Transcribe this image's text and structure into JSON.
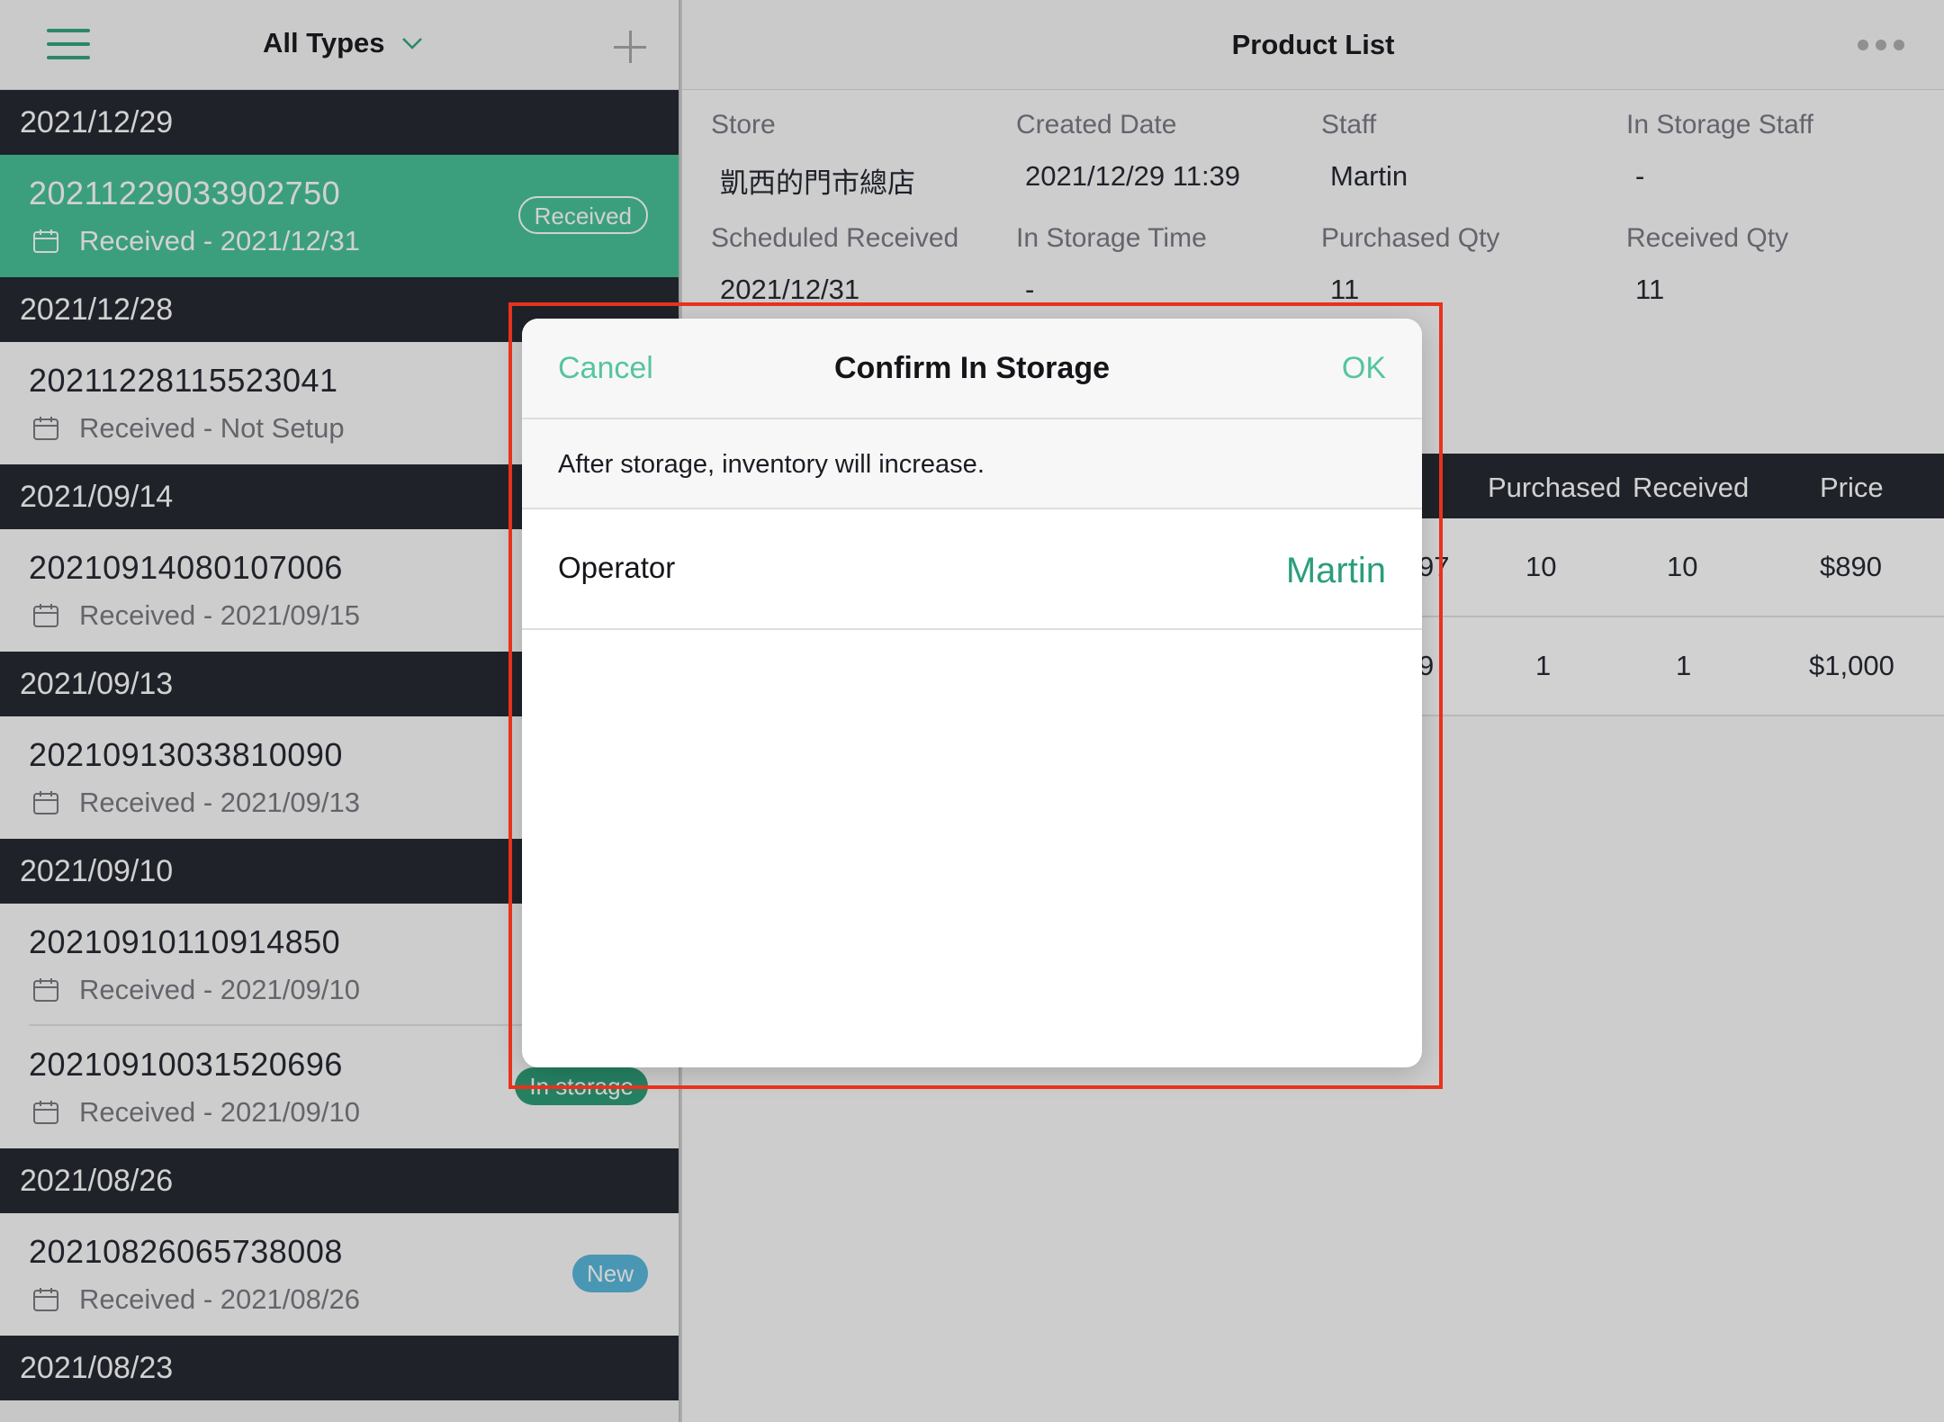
{
  "sidebar": {
    "filter_label": "All Types",
    "groups": [
      {
        "date": "2021/12/29",
        "orders": [
          {
            "number": "20211229033902750",
            "status": "Received - 2021/12/31",
            "badge": "Received"
          }
        ]
      },
      {
        "date": "2021/12/28",
        "orders": [
          {
            "number": "20211228115523041",
            "status": "Received - Not Setup"
          }
        ]
      },
      {
        "date": "2021/09/14",
        "orders": [
          {
            "number": "20210914080107006",
            "status": "Received - 2021/09/15"
          }
        ]
      },
      {
        "date": "2021/09/13",
        "orders": [
          {
            "number": "20210913033810090",
            "status": "Received - 2021/09/13"
          }
        ]
      },
      {
        "date": "2021/09/10",
        "orders": [
          {
            "number": "20210910110914850",
            "status": "Received - 2021/09/10"
          },
          {
            "number": "20210910031520696",
            "status": "Received - 2021/09/10",
            "badge": "In storage"
          }
        ]
      },
      {
        "date": "2021/08/26",
        "orders": [
          {
            "number": "20210826065738008",
            "status": "Received - 2021/08/26",
            "badge": "New"
          }
        ]
      },
      {
        "date": "2021/08/23",
        "orders": []
      }
    ]
  },
  "detail": {
    "title": "Product List",
    "fields": [
      {
        "label": "Store",
        "value": "凱西的門市總店"
      },
      {
        "label": "Created Date",
        "value": "2021/12/29 11:39"
      },
      {
        "label": "Staff",
        "value": "Martin"
      },
      {
        "label": "In Storage Staff",
        "value": "-"
      },
      {
        "label": "Scheduled Received",
        "value": "2021/12/31"
      },
      {
        "label": "In Storage Time",
        "value": "-"
      },
      {
        "label": "Purchased Qty",
        "value": "11"
      },
      {
        "label": "Received Qty",
        "value": "11"
      }
    ],
    "table": {
      "headers": {
        "purchased": "Purchased",
        "received": "Received",
        "price": "Price"
      },
      "rows": [
        {
          "code_tail": "97",
          "purchased": "10",
          "received": "10",
          "price": "$890"
        },
        {
          "code_tail": "9",
          "purchased": "1",
          "received": "1",
          "price": "$1,000"
        }
      ]
    }
  },
  "modal": {
    "cancel_label": "Cancel",
    "title": "Confirm In Storage",
    "ok_label": "OK",
    "note": "After storage, inventory will increase.",
    "operator_label": "Operator",
    "operator_value": "Martin"
  },
  "colors": {
    "accent": "#49c29a",
    "header_dark": "#272b33",
    "highlight": "#e8321c"
  }
}
